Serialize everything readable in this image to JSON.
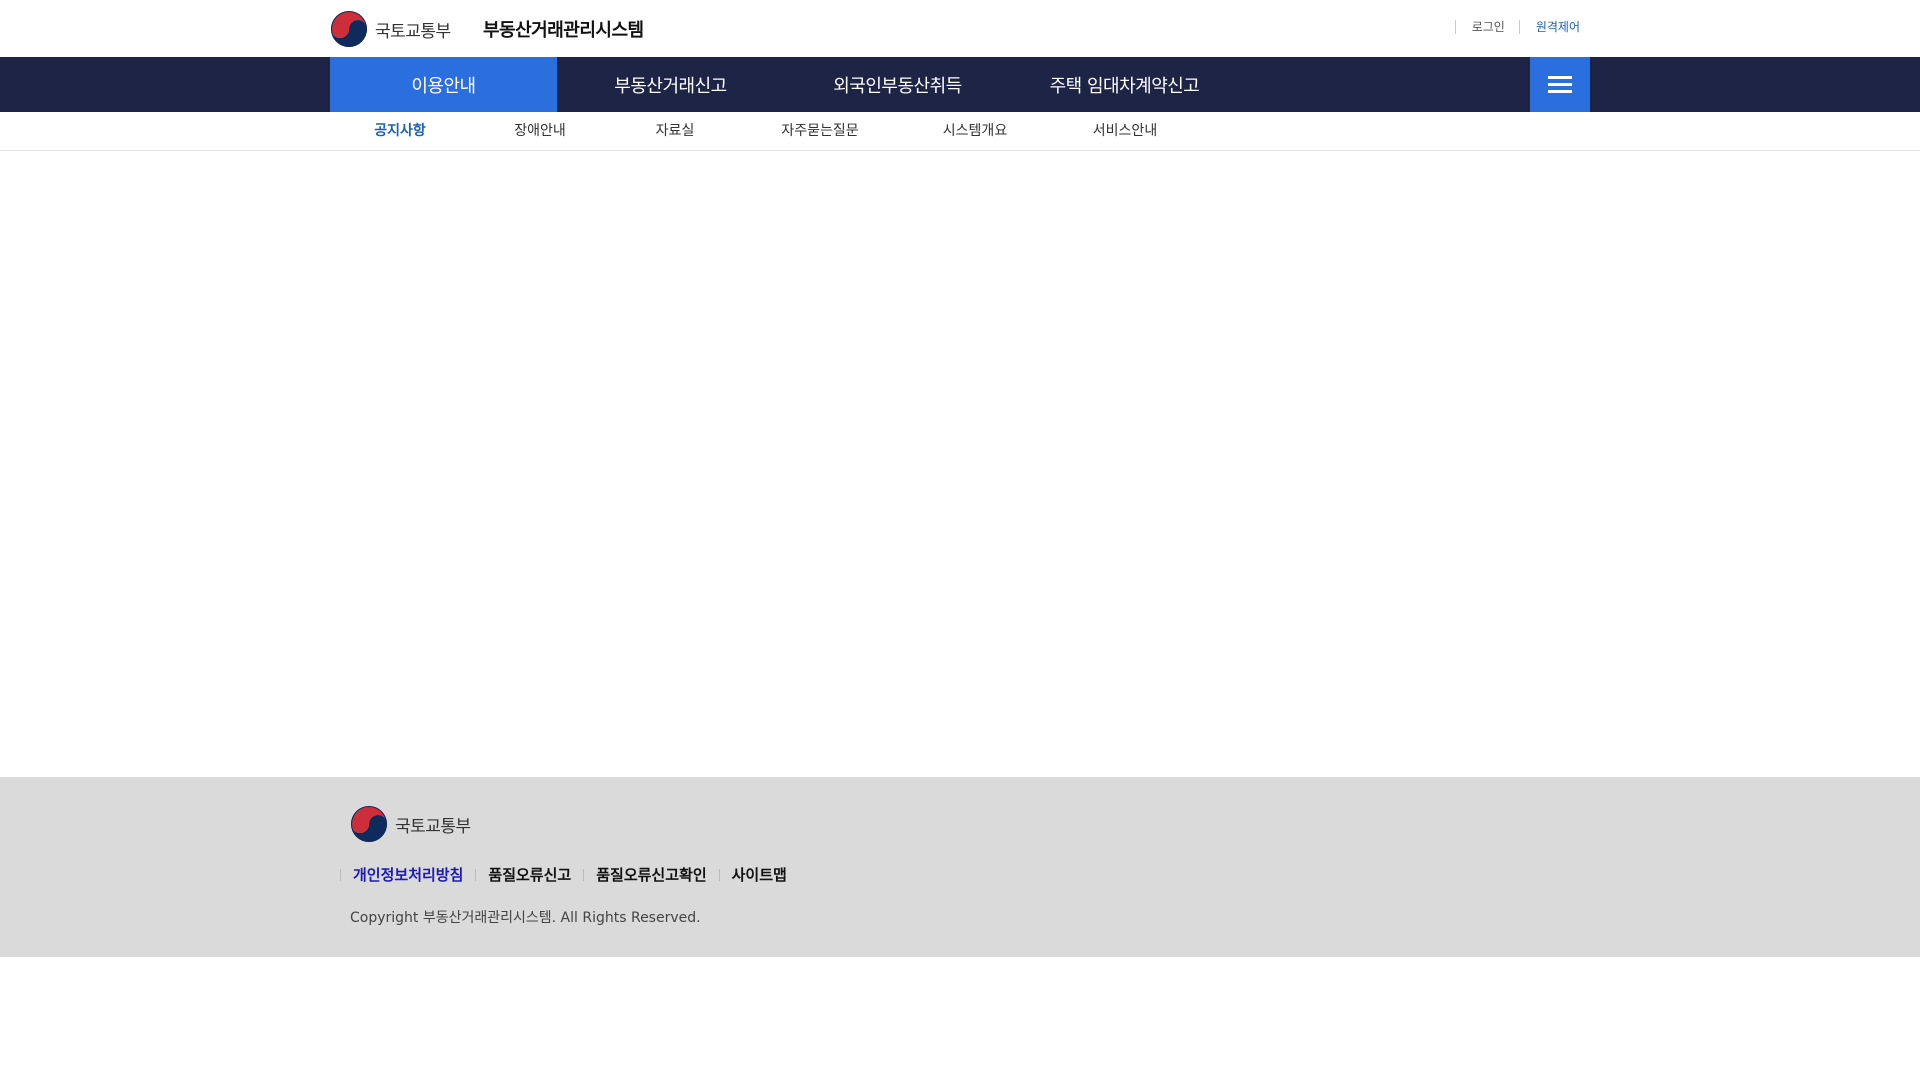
{
  "header": {
    "ministry": "국토교통부",
    "system_name": "부동산거래관리시스템",
    "login_label": "로그인",
    "remote_label": "원격제어"
  },
  "gnb": {
    "items": [
      {
        "label": "이용안내",
        "active": true
      },
      {
        "label": "부동산거래신고"
      },
      {
        "label": "외국인부동산취득"
      },
      {
        "label": "주택 임대차계약신고"
      }
    ],
    "menu_icon": "hamburger-icon"
  },
  "lnb": {
    "items": [
      {
        "label": "공지사항",
        "active": true
      },
      {
        "label": "장애안내"
      },
      {
        "label": "자료실"
      },
      {
        "label": "자주묻는질문"
      },
      {
        "label": "시스템개요"
      },
      {
        "label": "서비스안내"
      }
    ]
  },
  "footer": {
    "ministry": "국토교통부",
    "links": [
      "개인정보처리방침",
      "품질오류신고",
      "품질오류신고확인",
      "사이트맵"
    ],
    "copyright": "Copyright 부동산거래관리시스템. All Rights Reserved."
  },
  "colors": {
    "gnb_bg": "#1d2446",
    "accent": "#2b6fde",
    "link_blue": "#1f5fb4",
    "footer_bg": "#dadada"
  }
}
